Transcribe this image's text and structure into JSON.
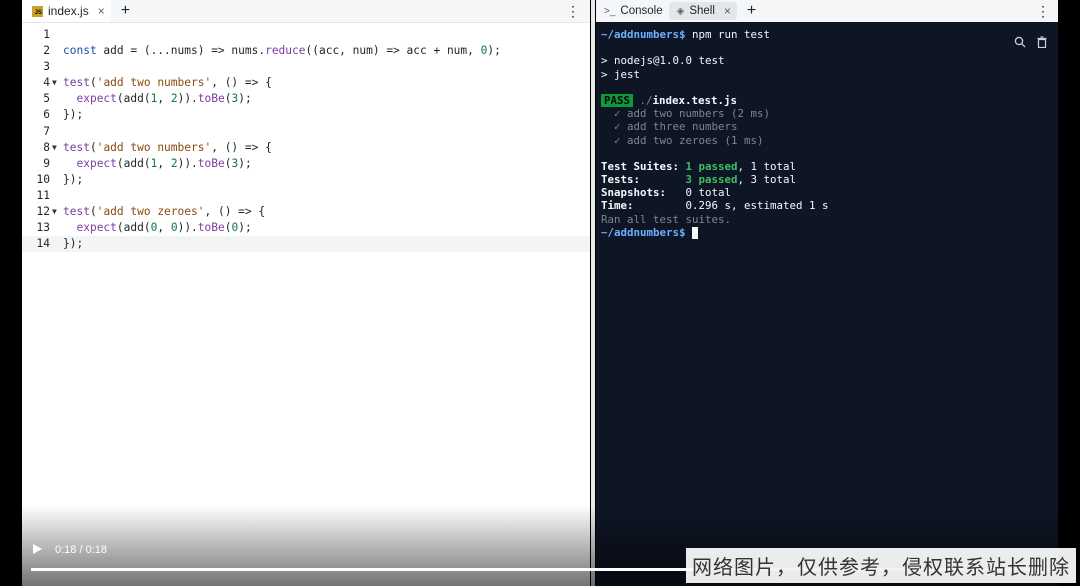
{
  "editor": {
    "tab_label": "index.js",
    "js_badge": "JS",
    "close": "×",
    "add": "+",
    "menu": "⋮",
    "line_numbers": [
      "1",
      "2",
      "3",
      "4",
      "5",
      "6",
      "7",
      "8",
      "9",
      "10",
      "11",
      "12",
      "13",
      "14"
    ]
  },
  "terminal": {
    "tab_console": "Console",
    "tab_shell": "Shell",
    "close": "×",
    "add": "+",
    "menu": "⋮",
    "console_icon": ">_",
    "prompt": "~/addnumbers$",
    "command": " npm run test",
    "out1": "> nodejs@1.0.0 test",
    "out2": "> jest",
    "pass": "PASS",
    "file_dir": " ./",
    "file_name": "index.test.js",
    "t1": "  ✓ add two numbers (2 ms)",
    "t2": "  ✓ add three numbers",
    "t3": "  ✓ add two zeroes (1 ms)",
    "suites_label": "Test Suites: ",
    "suites_passed": "1 passed",
    "suites_total": ", 1 total",
    "tests_label": "Tests:       ",
    "tests_passed": "3 passed",
    "tests_total": ", 3 total",
    "snap_label": "Snapshots:   ",
    "snap_value": "0 total",
    "time_label": "Time:        ",
    "time_value": "0.296 s, estimated 1 s",
    "ran": "Ran all test suites."
  },
  "video": {
    "time": "0:18 / 0:18",
    "progress": 0.65
  },
  "watermark": "网络图片，仅供参考，侵权联系站长删除"
}
